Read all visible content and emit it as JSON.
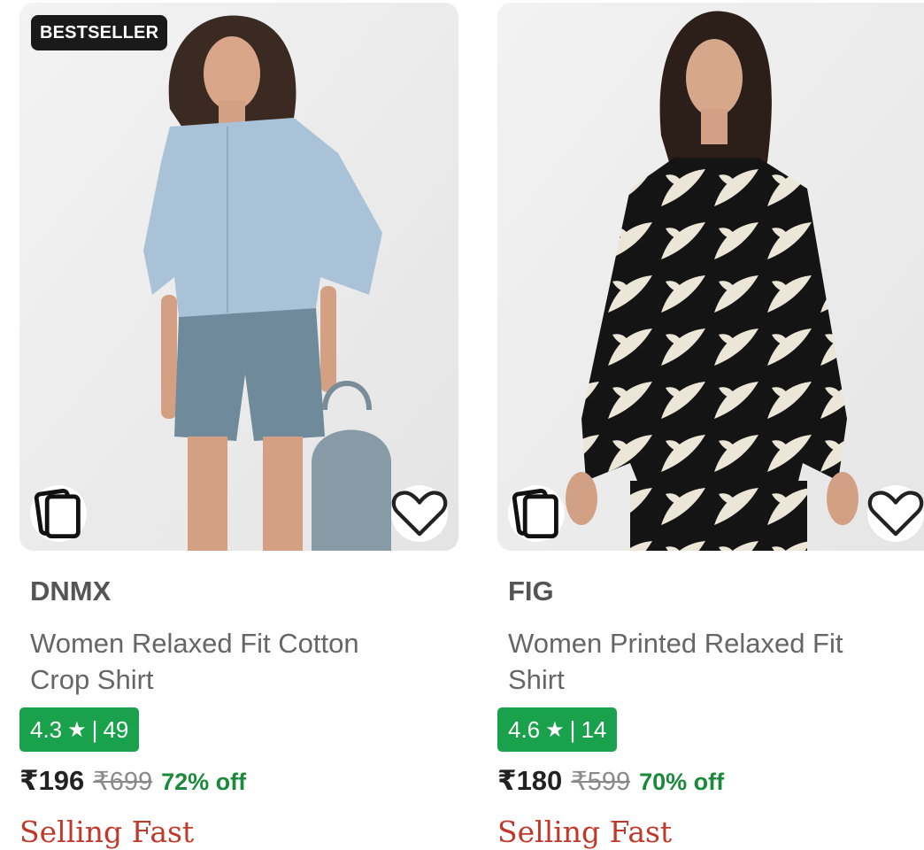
{
  "products": [
    {
      "badge": "BESTSELLER",
      "brand": "DNMX",
      "title": "Women Relaxed Fit Cotton Crop Shirt",
      "rating": "4.3",
      "rating_count": "49",
      "price": "₹196",
      "mrp": "₹699",
      "discount": "72% off",
      "urgency": "Selling Fast"
    },
    {
      "brand": "FIG",
      "title": "Women Printed Relaxed Fit Shirt",
      "rating": "4.6",
      "rating_count": "14",
      "price": "₹180",
      "mrp": "₹599",
      "discount": "70% off",
      "urgency": "Selling Fast"
    }
  ],
  "icons": {
    "rating_icon": "star-icon",
    "similar_icon": "similar-products-icon",
    "wishlist_icon": "heart-icon"
  },
  "colors": {
    "rating_bg": "#1aa14b",
    "discount": "#1a8a3a",
    "urgency": "#c0392b",
    "badge_bg": "#1a1a1a"
  }
}
